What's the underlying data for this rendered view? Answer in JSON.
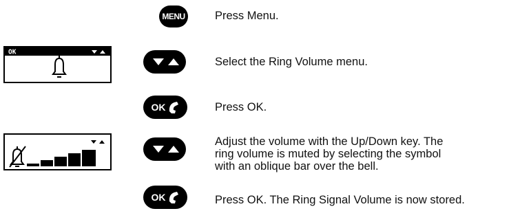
{
  "keys": {
    "menu_label": "MENU",
    "ok_label": "OK"
  },
  "display1": {
    "softkey_label": "OK"
  },
  "steps": [
    {
      "text": "Press Menu."
    },
    {
      "text": "Select the Ring Volume menu."
    },
    {
      "text": "Press OK."
    },
    {
      "lines": [
        "Adjust the volume with the Up/Down key. The",
        "ring volume is muted by selecting the symbol",
        "with an oblique bar over the bell."
      ]
    },
    {
      "text": "Press OK. The Ring Signal Volume is now stored."
    }
  ],
  "volume_display": {
    "levels": 5,
    "muted_symbol": "bell-muted-icon"
  },
  "icons": [
    "menu-key",
    "down-arrow-icon",
    "up-arrow-icon",
    "handset-icon",
    "bell-icon",
    "bell-muted-icon"
  ]
}
